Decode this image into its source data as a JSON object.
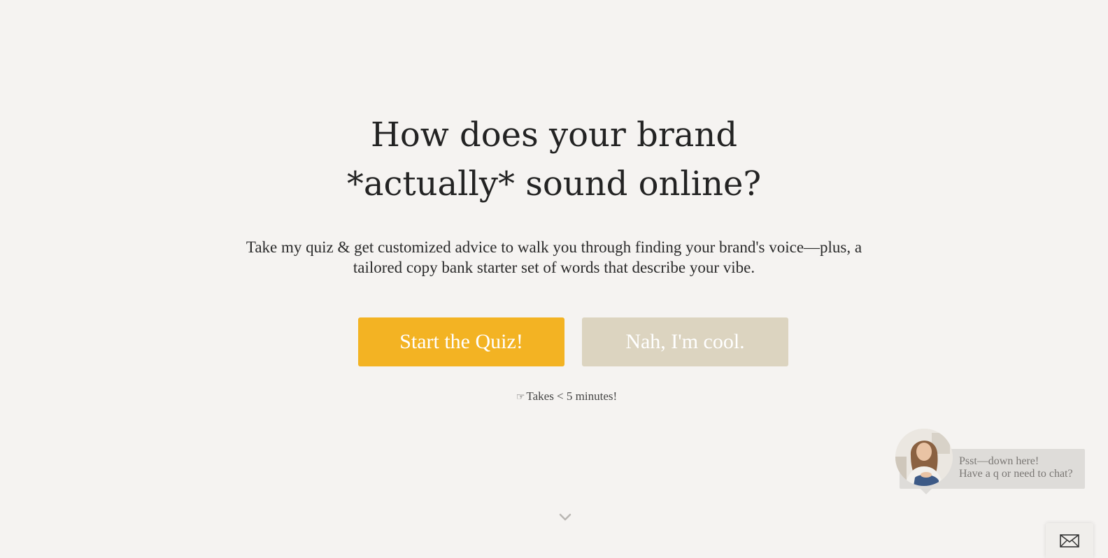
{
  "hero": {
    "title_line1": "How does your brand",
    "title_line2": "*actually* sound online?",
    "subtitle": "Take my quiz & get customized advice to walk you through finding your brand's voice—plus, a tailored copy bank starter set of words that describe your vibe."
  },
  "buttons": {
    "start_label": "Start the Quiz!",
    "decline_label": "Nah, I'm cool."
  },
  "time_note": {
    "icon": "pointing-hand-icon",
    "text": "Takes < 5 minutes!"
  },
  "chat": {
    "line1": "Psst—down here!",
    "line2": "Have a q or need to chat?",
    "avatar_icon": "avatar-photo",
    "mail_icon": "envelope-icon"
  },
  "colors": {
    "background": "#f5f3f1",
    "start_button": "#f3b323",
    "decline_button": "#dcd4c0",
    "chat_bubble": "#dedcd9"
  }
}
